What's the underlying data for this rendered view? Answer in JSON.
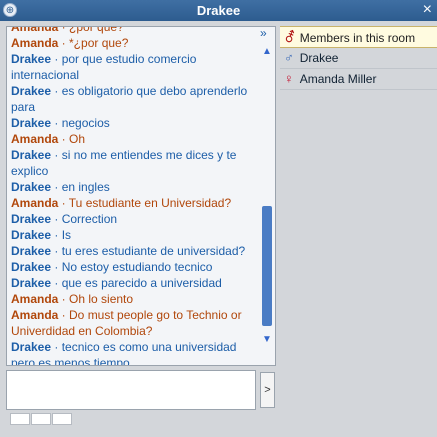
{
  "window": {
    "title": "Drakee",
    "close_icon": "×",
    "menu_icon": "⊕"
  },
  "chat": {
    "messages": [
      {
        "from": "Amanda",
        "text": "¿por que?"
      },
      {
        "from": "Amanda",
        "text": "*¿por que?"
      },
      {
        "from": "Drakee",
        "text": "por que estudio comercio internacional"
      },
      {
        "from": "Drakee",
        "text": "es obligatorio que debo aprenderlo para"
      },
      {
        "from": "Drakee",
        "text": "negocios"
      },
      {
        "from": "Amanda",
        "text": "Oh"
      },
      {
        "from": "Drakee",
        "text": "si no me entiendes me dices y te explico"
      },
      {
        "from": "Drakee",
        "text": "en ingles"
      },
      {
        "from": "Amanda",
        "text": "Tu estudiante en Universidad?"
      },
      {
        "from": "Drakee",
        "text": "Correction"
      },
      {
        "from": "Drakee",
        "text": "Is"
      },
      {
        "from": "Drakee",
        "text": "tu eres estudiante de universidad?"
      },
      {
        "from": "Drakee",
        "text": "No estoy estudiando tecnico"
      },
      {
        "from": "Drakee",
        "text": "que es parecido a universidad"
      },
      {
        "from": "Amanda",
        "text": "Oh lo siento"
      },
      {
        "from": "Amanda",
        "text": "Do must people go to Technio or Univerdidad en Colombia?"
      },
      {
        "from": "Drakee",
        "text": "tecnico es como una universidad pero es menos tiempo"
      }
    ]
  },
  "members": {
    "header": "Members in this room",
    "list": [
      {
        "name": "Drakee",
        "gender": "male"
      },
      {
        "name": "Amanda Miller",
        "gender": "female"
      }
    ]
  },
  "input": {
    "send_label": ">",
    "collapse_label": "»"
  }
}
